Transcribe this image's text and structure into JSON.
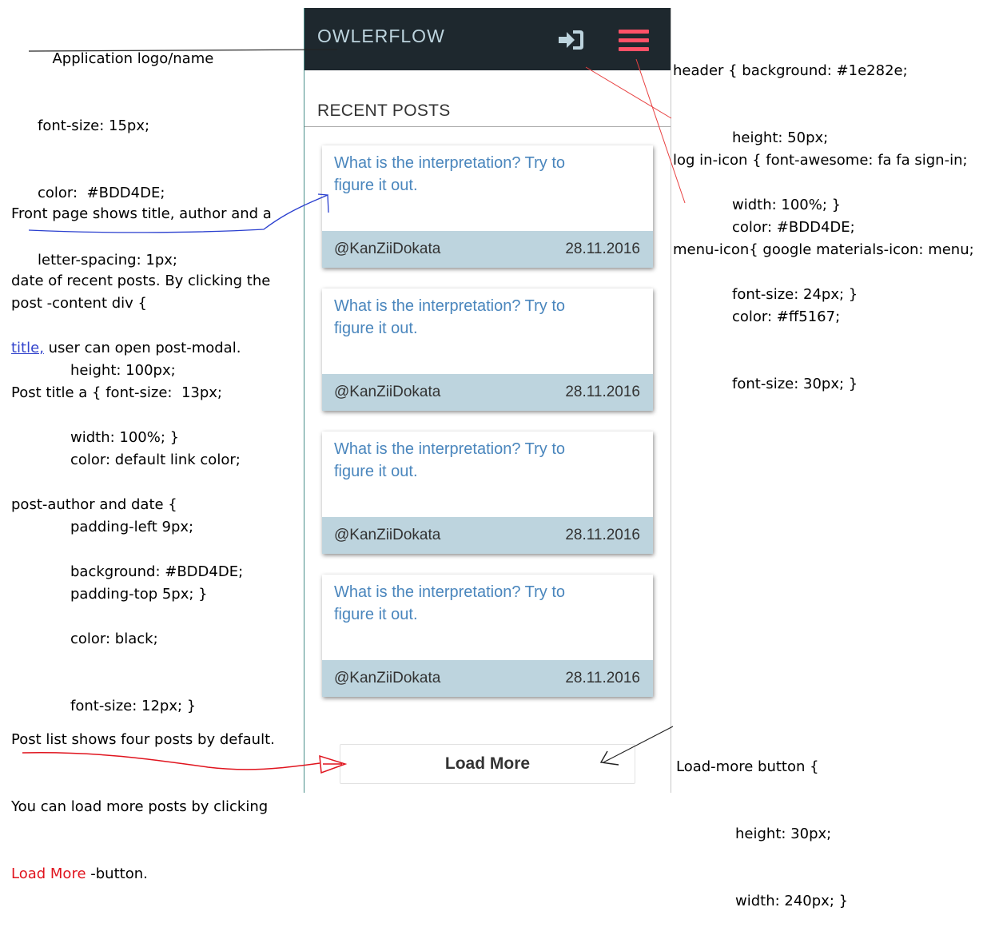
{
  "annotations": {
    "logo_label": "Application logo/name",
    "logo_css": [
      "font-size: 15px;",
      "color:  #BDD4DE;",
      "letter-spacing: 1px;"
    ],
    "front_page": {
      "line1": "Front page shows title, author and a",
      "line2": "date of recent posts. By clicking the",
      "link_word": "title,",
      "line3_rest": " user can open post-modal."
    },
    "post_content_css": [
      "post -content div {",
      "height: 100px;",
      "width: 100%; }"
    ],
    "post_title_css": [
      "Post title a { font-size:  13px;",
      "color: default link color;",
      "padding-left 9px;",
      "padding-top 5px; }"
    ],
    "post_meta_css": [
      "post-author and date {",
      "background: #BDD4DE;",
      "color: black;",
      "font-size: 12px; }"
    ],
    "post_list_note": {
      "line1": "Post list shows four posts by default.",
      "line2": "You can load more posts by clicking",
      "red_word": "Load More",
      "line3_rest": " -button."
    },
    "header_css": [
      "header { background: #1e282e;",
      "height: 50px;",
      "width: 100%; }"
    ],
    "login_icon_css": [
      "log in-icon { font-awesome: fa fa sign-in;",
      "color: #BDD4DE;",
      "font-size: 24px; }"
    ],
    "menu_icon_css": [
      "menu-icon{ google materials-icon: menu;",
      "color: #ff5167;",
      "font-size: 30px; }"
    ],
    "load_more_css": [
      "Load-more button {",
      "height: 30px;",
      "width: 240px; }"
    ]
  },
  "app": {
    "logo": "OWLERFLOW",
    "section_title": "RECENT POSTS",
    "posts": [
      {
        "title": "What is the interpretation? Try to figure it out.",
        "author": "@KanZiiDokata",
        "date": "28.11.2016"
      },
      {
        "title": "What is the interpretation? Try to figure it out.",
        "author": "@KanZiiDokata",
        "date": "28.11.2016"
      },
      {
        "title": "What is the interpretation? Try to figure it out.",
        "author": "@KanZiiDokata",
        "date": "28.11.2016"
      },
      {
        "title": "What is the interpretation? Try to figure it out.",
        "author": "@KanZiiDokata",
        "date": "28.11.2016"
      }
    ],
    "load_more_label": "Load More"
  },
  "colors": {
    "header_bg": "#1e282e",
    "logo": "#BDD4DE",
    "login_icon": "#BDD4DE",
    "menu_icon": "#ff5167",
    "post_meta_bg": "#BDD4DE",
    "post_title": "#4a86bd"
  },
  "icons": {
    "login": "sign-in-icon",
    "menu": "menu-icon"
  }
}
